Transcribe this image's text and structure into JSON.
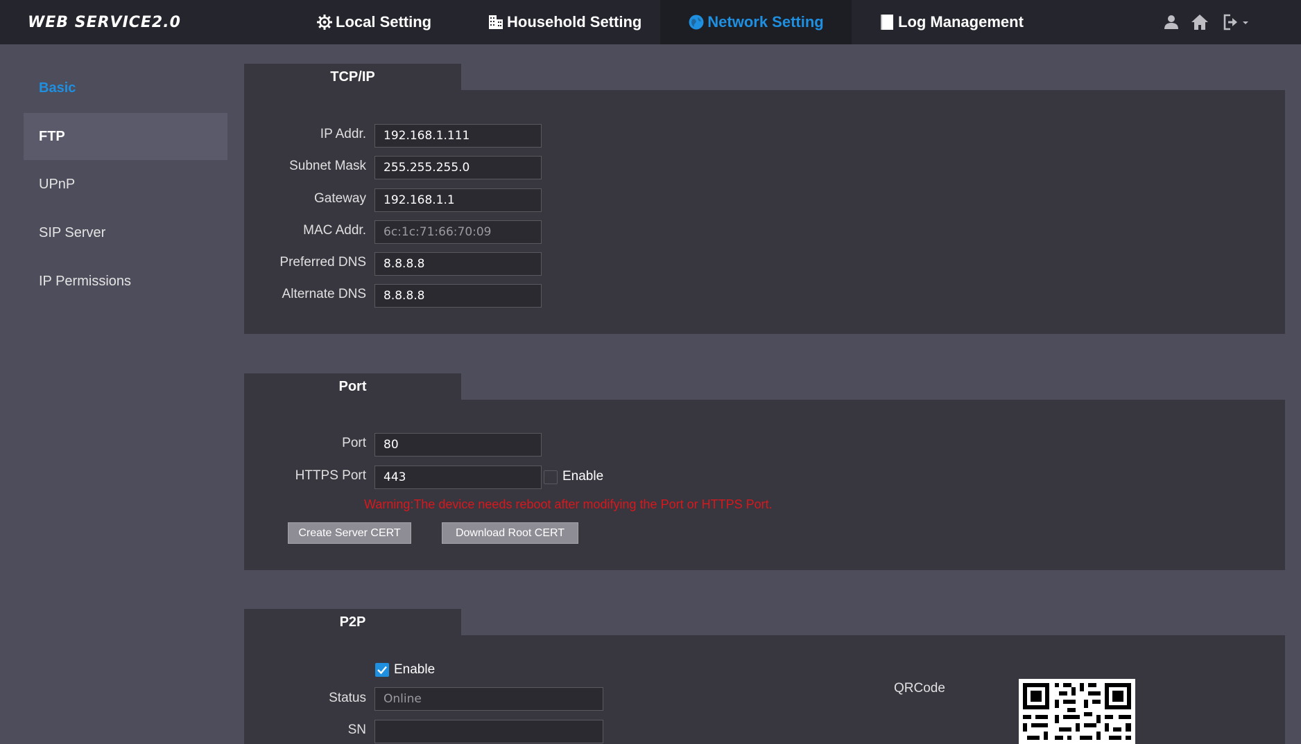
{
  "brand": "WEB SERVICE2.0",
  "nav": {
    "local": "Local Setting",
    "household": "Household Setting",
    "network": "Network Setting",
    "log": "Log Management"
  },
  "icons": {
    "user": "user-icon",
    "home": "home-icon",
    "logout": "logout-icon",
    "local": "gear-icon",
    "household": "building-icon",
    "network": "globe-icon",
    "log": "document-icon"
  },
  "colors": {
    "accent": "#1f8fe0",
    "warning": "#d8181c",
    "topbar": "#25252d",
    "panel": "#38363f",
    "background": "#4e4d5b"
  },
  "sidebar": {
    "items": [
      {
        "label": "Basic"
      },
      {
        "label": "FTP"
      },
      {
        "label": "UPnP"
      },
      {
        "label": "SIP Server"
      },
      {
        "label": "IP Permissions"
      }
    ]
  },
  "tcpip": {
    "title": "TCP/IP",
    "ip_label": "IP Addr.",
    "ip": "192.168.1.111",
    "subnet_label": "Subnet Mask",
    "subnet": "255.255.255.0",
    "gateway_label": "Gateway",
    "gateway": "192.168.1.1",
    "mac_label": "MAC Addr.",
    "mac": "6c:1c:71:66:70:09",
    "dns1_label": "Preferred DNS",
    "dns1": "8.8.8.8",
    "dns2_label": "Alternate DNS",
    "dns2": "8.8.8.8"
  },
  "port": {
    "title": "Port",
    "port_label": "Port",
    "port": "80",
    "https_label": "HTTPS Port",
    "https": "443",
    "https_enable_label": "Enable",
    "https_enabled": false,
    "warning": "Warning:The device needs reboot after modifying the Port or HTTPS Port.",
    "create_cert": "Create Server CERT",
    "download_cert": "Download Root CERT"
  },
  "p2p": {
    "title": "P2P",
    "enable_label": "Enable",
    "enabled": true,
    "status_label": "Status",
    "status": "Online",
    "sn_label": "SN",
    "sn": "",
    "qr_label": "QRCode"
  }
}
